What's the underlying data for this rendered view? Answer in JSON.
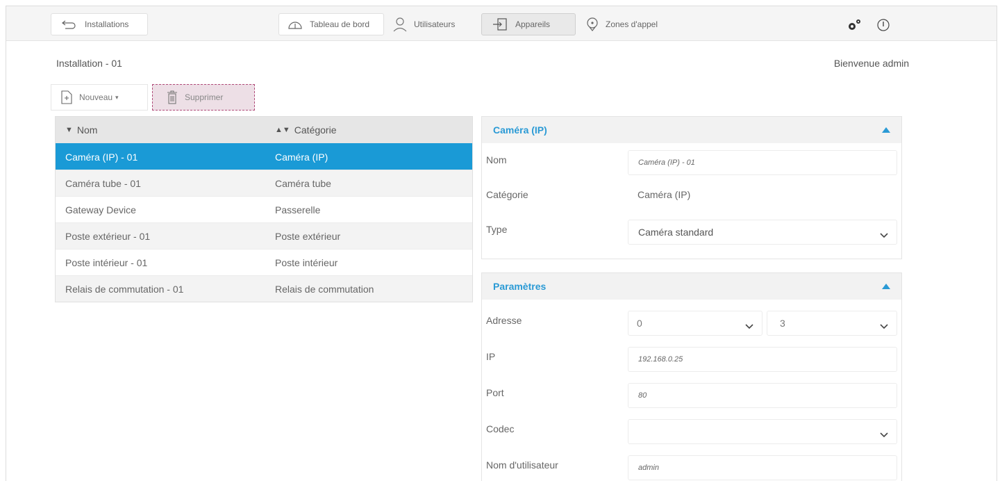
{
  "topbar": {
    "back_label": "Installations",
    "tabs": [
      {
        "label": "Tableau de bord",
        "icon": "dashboard-icon"
      },
      {
        "label": "Utilisateurs",
        "icon": "user-icon"
      },
      {
        "label": "Appareils",
        "icon": "device-icon",
        "active": true
      },
      {
        "label": "Zones d'appel",
        "icon": "location-icon"
      }
    ],
    "settings_icon": "gears-icon",
    "info_icon": "info-icon"
  },
  "header": {
    "installation": "Installation - 01",
    "welcome": "Bienvenue admin"
  },
  "toolbar": {
    "new_label": "Nouveau",
    "delete_label": "Supprimer"
  },
  "table": {
    "columns": [
      "Nom",
      "Catégorie"
    ],
    "rows": [
      {
        "name": "Caméra (IP) - 01",
        "category": "Caméra (IP)",
        "selected": true
      },
      {
        "name": "Caméra tube - 01",
        "category": "Caméra tube"
      },
      {
        "name": "Gateway Device",
        "category": "Passerelle"
      },
      {
        "name": "Poste extérieur - 01",
        "category": "Poste extérieur"
      },
      {
        "name": "Poste intérieur - 01",
        "category": "Poste intérieur"
      },
      {
        "name": "Relais de commutation - 01",
        "category": "Relais de commutation"
      }
    ]
  },
  "device_panel": {
    "title": "Caméra (IP)",
    "nom_label": "Nom",
    "nom_value": "Caméra (IP) - 01",
    "categorie_label": "Catégorie",
    "categorie_value": "Caméra (IP)",
    "type_label": "Type",
    "type_value": "Caméra standard"
  },
  "params_panel": {
    "title": "Paramètres",
    "adresse_label": "Adresse",
    "adresse_value_1": "0",
    "adresse_value_2": "3",
    "ip_label": "IP",
    "ip_value": "192.168.0.25",
    "port_label": "Port",
    "port_value": "80",
    "codec_label": "Codec",
    "codec_value": "",
    "user_label": "Nom d'utilisateur",
    "user_value": "admin"
  },
  "colors": {
    "accent": "#1a9ad6",
    "delete_bg": "#eddfe6",
    "delete_border": "#b04a78"
  }
}
